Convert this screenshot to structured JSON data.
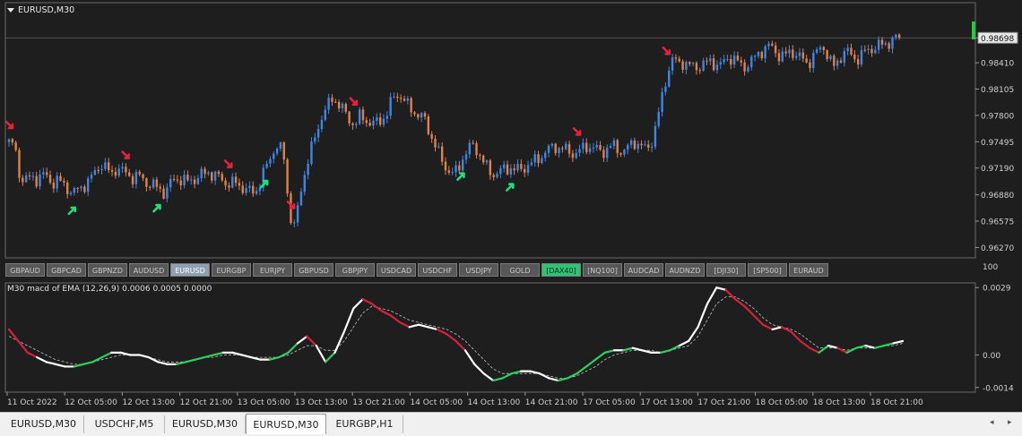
{
  "window": {
    "title": "EURUSD,M30"
  },
  "price_axis": {
    "labels": [
      "0.98698",
      "0.98410",
      "0.98105",
      "0.97800",
      "0.97495",
      "0.97190",
      "0.96880",
      "0.96575",
      "0.96270"
    ],
    "current_price": "0.98698",
    "range": [
      0.9615,
      0.9895
    ]
  },
  "symbol_buttons": [
    {
      "label": "GBPAUD",
      "state": "normal"
    },
    {
      "label": "GBPCAD",
      "state": "normal"
    },
    {
      "label": "GBPNZD",
      "state": "normal"
    },
    {
      "label": "AUDUSD",
      "state": "normal"
    },
    {
      "label": "EURUSD",
      "state": "active"
    },
    {
      "label": "EURGBP",
      "state": "normal"
    },
    {
      "label": "EURJPY",
      "state": "normal"
    },
    {
      "label": "GBPUSD",
      "state": "normal"
    },
    {
      "label": "GBPJPY",
      "state": "normal"
    },
    {
      "label": "USDCAD",
      "state": "normal"
    },
    {
      "label": "USDCHF",
      "state": "normal"
    },
    {
      "label": "USDJPY",
      "state": "normal"
    },
    {
      "label": "GOLD",
      "state": "normal"
    },
    {
      "label": "[DAX40]",
      "state": "green"
    },
    {
      "label": "[NQ100]",
      "state": "normal"
    },
    {
      "label": "AUDCAD",
      "state": "normal"
    },
    {
      "label": "AUDNZD",
      "state": "normal"
    },
    {
      "label": "[DJI30]",
      "state": "normal"
    },
    {
      "label": "[SP500]",
      "state": "normal"
    },
    {
      "label": "EURAUD",
      "state": "normal"
    }
  ],
  "separator_label": "100",
  "macd": {
    "label": "M30  macd of EMA  (12,26,9) 0.0006 0.0005 0.0000",
    "axis_labels": [
      "0.0029",
      "0.00",
      "-0.0014"
    ],
    "range": [
      -0.0016,
      0.0031
    ]
  },
  "time_axis": {
    "labels": [
      "11 Oct 2022",
      "12 Oct 05:00",
      "12 Oct 13:00",
      "12 Oct 21:00",
      "13 Oct 05:00",
      "13 Oct 13:00",
      "13 Oct 21:00",
      "14 Oct 05:00",
      "14 Oct 13:00",
      "14 Oct 21:00",
      "17 Oct 05:00",
      "17 Oct 13:00",
      "17 Oct 21:00",
      "18 Oct 05:00",
      "18 Oct 13:00",
      "18 Oct 21:00"
    ]
  },
  "tabs": [
    {
      "label": "EURUSD,M30",
      "active": false
    },
    {
      "label": "USDCHF,M5",
      "active": false
    },
    {
      "label": "EURUSD,M30",
      "active": false
    },
    {
      "label": "EURUSD,M30",
      "active": true
    },
    {
      "label": "EURGBP,H1",
      "active": false
    }
  ],
  "scroll": {
    "left": "◂",
    "right": "▸"
  },
  "colors": {
    "bull": "#3d86e6",
    "bear": "#e0824a",
    "arrow_up": "#1fe07a",
    "arrow_down": "#e8203c",
    "macd_line": "#ffffff",
    "macd_up": "#2fd060",
    "macd_down": "#d8203a",
    "signal": "#bfbfbf",
    "indicator_bar": "#27c93f"
  },
  "chart_data": [
    {
      "type": "candlestick",
      "title": "EURUSD,M30",
      "ylim": [
        0.9615,
        0.9895
      ],
      "x_tick_labels": [
        "11 Oct 2022",
        "12 Oct 05:00",
        "12 Oct 13:00",
        "12 Oct 21:00",
        "13 Oct 05:00",
        "13 Oct 13:00",
        "13 Oct 21:00",
        "14 Oct 05:00",
        "14 Oct 13:00",
        "14 Oct 21:00",
        "17 Oct 05:00",
        "17 Oct 13:00",
        "17 Oct 21:00",
        "18 Oct 05:00",
        "18 Oct 13:00",
        "18 Oct 21:00"
      ],
      "y_tick_labels": [
        "0.98698",
        "0.98410",
        "0.98105",
        "0.97800",
        "0.97495",
        "0.97190",
        "0.96880",
        "0.96575",
        "0.96270"
      ],
      "close_path": [
        0.9749,
        0.9745,
        0.971,
        0.9705,
        0.9708,
        0.9706,
        0.9712,
        0.9708,
        0.9702,
        0.9705,
        0.97,
        0.9695,
        0.969,
        0.9695,
        0.97,
        0.9705,
        0.9715,
        0.9725,
        0.9718,
        0.9712,
        0.972,
        0.9715,
        0.9712,
        0.9708,
        0.971,
        0.9705,
        0.97,
        0.9698,
        0.9695,
        0.969,
        0.9702,
        0.9708,
        0.9705,
        0.9703,
        0.9706,
        0.9708,
        0.9712,
        0.9715,
        0.971,
        0.9708,
        0.9703,
        0.97,
        0.9702,
        0.9698,
        0.9694,
        0.969,
        0.9695,
        0.971,
        0.9725,
        0.974,
        0.9745,
        0.973,
        0.9665,
        0.965,
        0.969,
        0.972,
        0.974,
        0.976,
        0.978,
        0.979,
        0.98,
        0.9795,
        0.9785,
        0.9775,
        0.977,
        0.9778,
        0.9775,
        0.9772,
        0.977,
        0.9775,
        0.9782,
        0.9798,
        0.9805,
        0.98,
        0.979,
        0.9785,
        0.978,
        0.9775,
        0.976,
        0.9745,
        0.973,
        0.972,
        0.9712,
        0.9715,
        0.973,
        0.974,
        0.9745,
        0.9738,
        0.9725,
        0.9715,
        0.9712,
        0.9715,
        0.9718,
        0.972,
        0.9716,
        0.9718,
        0.9722,
        0.9725,
        0.973,
        0.9735,
        0.974,
        0.9745,
        0.9742,
        0.974,
        0.9738,
        0.9735,
        0.974,
        0.9745,
        0.9743,
        0.974,
        0.9738,
        0.9742,
        0.9745,
        0.974,
        0.9738,
        0.9745,
        0.975,
        0.9745,
        0.974,
        0.9748,
        0.977,
        0.98,
        0.983,
        0.9845,
        0.984,
        0.9842,
        0.9838,
        0.9835,
        0.9838,
        0.984,
        0.9842,
        0.984,
        0.9838,
        0.9845,
        0.9848,
        0.9842,
        0.9835,
        0.984,
        0.9845,
        0.9852,
        0.9858,
        0.986,
        0.9855,
        0.9848,
        0.985,
        0.9855,
        0.985,
        0.9845,
        0.984,
        0.9848,
        0.9855,
        0.986,
        0.9845,
        0.9835,
        0.9848,
        0.9855,
        0.985,
        0.9845,
        0.985,
        0.9855,
        0.9858,
        0.986,
        0.9862,
        0.9865,
        0.9868,
        0.987
      ],
      "annotations": {
        "up_arrows_at": [
          0.075,
          0.17,
          0.29,
          0.51,
          0.565
        ],
        "down_arrows_at": [
          0.005,
          0.135,
          0.25,
          0.32,
          0.39,
          0.64,
          0.74
        ]
      }
    },
    {
      "type": "line",
      "title": "M30  macd of EMA  (12,26,9) 0.0006 0.0005 0.0000",
      "ylim": [
        -0.0016,
        0.0031
      ],
      "y_tick_labels": [
        "0.0029",
        "0.00",
        "-0.0014"
      ],
      "series": [
        {
          "values": [
            0.0011,
            0.0006,
            0.0001,
            -0.0001,
            -0.0003,
            -0.0004,
            -0.0005,
            -0.0005,
            -0.0004,
            -0.0003,
            -0.0001,
            0.0001,
            0.0001,
            0.0,
            0.0,
            -0.0001,
            -0.0003,
            -0.0004,
            -0.0004,
            -0.0003,
            -0.0002,
            -0.0001,
            0.0,
            0.0001,
            0.0001,
            0.0,
            -0.0001,
            -0.0002,
            -0.0002,
            -0.0001,
            0.0001,
            0.0005,
            0.0008,
            0.0004,
            -0.0003,
            0.0001,
            0.001,
            0.002,
            0.0024,
            0.0022,
            0.0019,
            0.0017,
            0.0014,
            0.0012,
            0.0013,
            0.0012,
            0.0011,
            0.0009,
            0.0006,
            0.0002,
            -0.0004,
            -0.0008,
            -0.0011,
            -0.001,
            -0.0008,
            -0.0007,
            -0.0007,
            -0.0008,
            -0.001,
            -0.0011,
            -0.001,
            -0.0008,
            -0.0005,
            -0.0002,
            0.0001,
            0.0002,
            0.0002,
            0.0003,
            0.0002,
            0.0001,
            0.0001,
            0.0002,
            0.0004,
            0.0006,
            0.0012,
            0.0022,
            0.0029,
            0.0028,
            0.0024,
            0.0021,
            0.0017,
            0.0013,
            0.0011,
            0.0012,
            0.001,
            0.0006,
            0.0003,
            0.0001,
            0.0004,
            0.0003,
            0.0001,
            0.0003,
            0.0004,
            0.0003,
            0.0004,
            0.0005,
            0.0006
          ]
        },
        {
          "values": [
            0.0008,
            0.0006,
            0.0004,
            0.0002,
            0.0,
            -0.0002,
            -0.0003,
            -0.0004,
            -0.0004,
            -0.0003,
            -0.0002,
            -0.0001,
            0.0,
            0.0,
            0.0,
            -0.0001,
            -0.0002,
            -0.0003,
            -0.0003,
            -0.0003,
            -0.0002,
            -0.0001,
            -0.0001,
            0.0,
            0.0,
            0.0,
            -0.0001,
            -0.0001,
            -0.0001,
            -0.0001,
            0.0,
            0.0002,
            0.0004,
            0.0004,
            0.0002,
            0.0002,
            0.0006,
            0.0012,
            0.0018,
            0.0021,
            0.002,
            0.0019,
            0.0017,
            0.0015,
            0.0014,
            0.0013,
            0.0012,
            0.0011,
            0.0009,
            0.0006,
            0.0002,
            -0.0002,
            -0.0006,
            -0.0008,
            -0.0008,
            -0.0008,
            -0.0008,
            -0.0008,
            -0.0009,
            -0.001,
            -0.001,
            -0.0009,
            -0.0007,
            -0.0005,
            -0.0002,
            0.0,
            0.0001,
            0.0002,
            0.0002,
            0.0002,
            0.0001,
            0.0002,
            0.0003,
            0.0004,
            0.0008,
            0.0015,
            0.0022,
            0.0025,
            0.0025,
            0.0023,
            0.002,
            0.0016,
            0.0013,
            0.0012,
            0.0011,
            0.0009,
            0.0006,
            0.0003,
            0.0003,
            0.0003,
            0.0002,
            0.0003,
            0.0003,
            0.0003,
            0.0004,
            0.0004,
            0.0005
          ]
        }
      ]
    }
  ]
}
